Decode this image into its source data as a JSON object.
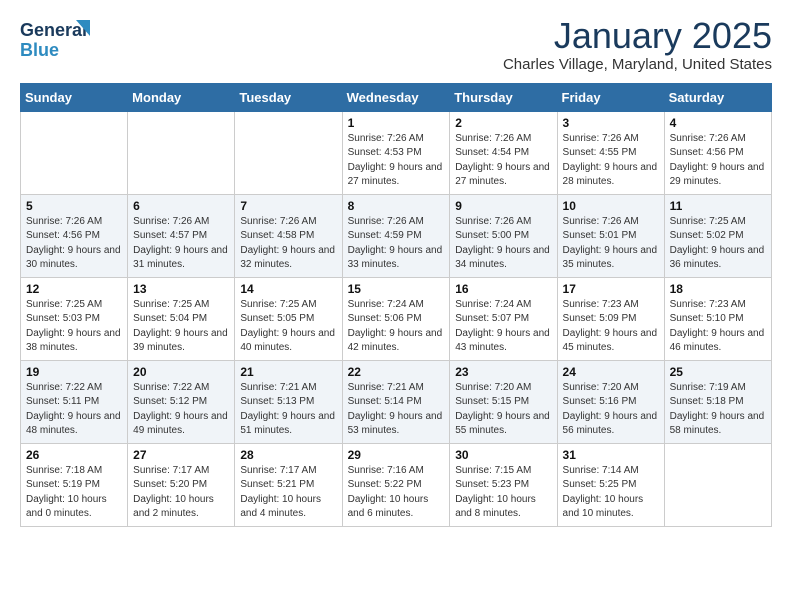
{
  "header": {
    "logo_general": "General",
    "logo_blue": "Blue",
    "month_title": "January 2025",
    "location": "Charles Village, Maryland, United States"
  },
  "weekdays": [
    "Sunday",
    "Monday",
    "Tuesday",
    "Wednesday",
    "Thursday",
    "Friday",
    "Saturday"
  ],
  "weeks": [
    [
      {
        "day": "",
        "info": ""
      },
      {
        "day": "",
        "info": ""
      },
      {
        "day": "",
        "info": ""
      },
      {
        "day": "1",
        "info": "Sunrise: 7:26 AM\nSunset: 4:53 PM\nDaylight: 9 hours and 27 minutes."
      },
      {
        "day": "2",
        "info": "Sunrise: 7:26 AM\nSunset: 4:54 PM\nDaylight: 9 hours and 27 minutes."
      },
      {
        "day": "3",
        "info": "Sunrise: 7:26 AM\nSunset: 4:55 PM\nDaylight: 9 hours and 28 minutes."
      },
      {
        "day": "4",
        "info": "Sunrise: 7:26 AM\nSunset: 4:56 PM\nDaylight: 9 hours and 29 minutes."
      }
    ],
    [
      {
        "day": "5",
        "info": "Sunrise: 7:26 AM\nSunset: 4:56 PM\nDaylight: 9 hours and 30 minutes."
      },
      {
        "day": "6",
        "info": "Sunrise: 7:26 AM\nSunset: 4:57 PM\nDaylight: 9 hours and 31 minutes."
      },
      {
        "day": "7",
        "info": "Sunrise: 7:26 AM\nSunset: 4:58 PM\nDaylight: 9 hours and 32 minutes."
      },
      {
        "day": "8",
        "info": "Sunrise: 7:26 AM\nSunset: 4:59 PM\nDaylight: 9 hours and 33 minutes."
      },
      {
        "day": "9",
        "info": "Sunrise: 7:26 AM\nSunset: 5:00 PM\nDaylight: 9 hours and 34 minutes."
      },
      {
        "day": "10",
        "info": "Sunrise: 7:26 AM\nSunset: 5:01 PM\nDaylight: 9 hours and 35 minutes."
      },
      {
        "day": "11",
        "info": "Sunrise: 7:25 AM\nSunset: 5:02 PM\nDaylight: 9 hours and 36 minutes."
      }
    ],
    [
      {
        "day": "12",
        "info": "Sunrise: 7:25 AM\nSunset: 5:03 PM\nDaylight: 9 hours and 38 minutes."
      },
      {
        "day": "13",
        "info": "Sunrise: 7:25 AM\nSunset: 5:04 PM\nDaylight: 9 hours and 39 minutes."
      },
      {
        "day": "14",
        "info": "Sunrise: 7:25 AM\nSunset: 5:05 PM\nDaylight: 9 hours and 40 minutes."
      },
      {
        "day": "15",
        "info": "Sunrise: 7:24 AM\nSunset: 5:06 PM\nDaylight: 9 hours and 42 minutes."
      },
      {
        "day": "16",
        "info": "Sunrise: 7:24 AM\nSunset: 5:07 PM\nDaylight: 9 hours and 43 minutes."
      },
      {
        "day": "17",
        "info": "Sunrise: 7:23 AM\nSunset: 5:09 PM\nDaylight: 9 hours and 45 minutes."
      },
      {
        "day": "18",
        "info": "Sunrise: 7:23 AM\nSunset: 5:10 PM\nDaylight: 9 hours and 46 minutes."
      }
    ],
    [
      {
        "day": "19",
        "info": "Sunrise: 7:22 AM\nSunset: 5:11 PM\nDaylight: 9 hours and 48 minutes."
      },
      {
        "day": "20",
        "info": "Sunrise: 7:22 AM\nSunset: 5:12 PM\nDaylight: 9 hours and 49 minutes."
      },
      {
        "day": "21",
        "info": "Sunrise: 7:21 AM\nSunset: 5:13 PM\nDaylight: 9 hours and 51 minutes."
      },
      {
        "day": "22",
        "info": "Sunrise: 7:21 AM\nSunset: 5:14 PM\nDaylight: 9 hours and 53 minutes."
      },
      {
        "day": "23",
        "info": "Sunrise: 7:20 AM\nSunset: 5:15 PM\nDaylight: 9 hours and 55 minutes."
      },
      {
        "day": "24",
        "info": "Sunrise: 7:20 AM\nSunset: 5:16 PM\nDaylight: 9 hours and 56 minutes."
      },
      {
        "day": "25",
        "info": "Sunrise: 7:19 AM\nSunset: 5:18 PM\nDaylight: 9 hours and 58 minutes."
      }
    ],
    [
      {
        "day": "26",
        "info": "Sunrise: 7:18 AM\nSunset: 5:19 PM\nDaylight: 10 hours and 0 minutes."
      },
      {
        "day": "27",
        "info": "Sunrise: 7:17 AM\nSunset: 5:20 PM\nDaylight: 10 hours and 2 minutes."
      },
      {
        "day": "28",
        "info": "Sunrise: 7:17 AM\nSunset: 5:21 PM\nDaylight: 10 hours and 4 minutes."
      },
      {
        "day": "29",
        "info": "Sunrise: 7:16 AM\nSunset: 5:22 PM\nDaylight: 10 hours and 6 minutes."
      },
      {
        "day": "30",
        "info": "Sunrise: 7:15 AM\nSunset: 5:23 PM\nDaylight: 10 hours and 8 minutes."
      },
      {
        "day": "31",
        "info": "Sunrise: 7:14 AM\nSunset: 5:25 PM\nDaylight: 10 hours and 10 minutes."
      },
      {
        "day": "",
        "info": ""
      }
    ]
  ]
}
